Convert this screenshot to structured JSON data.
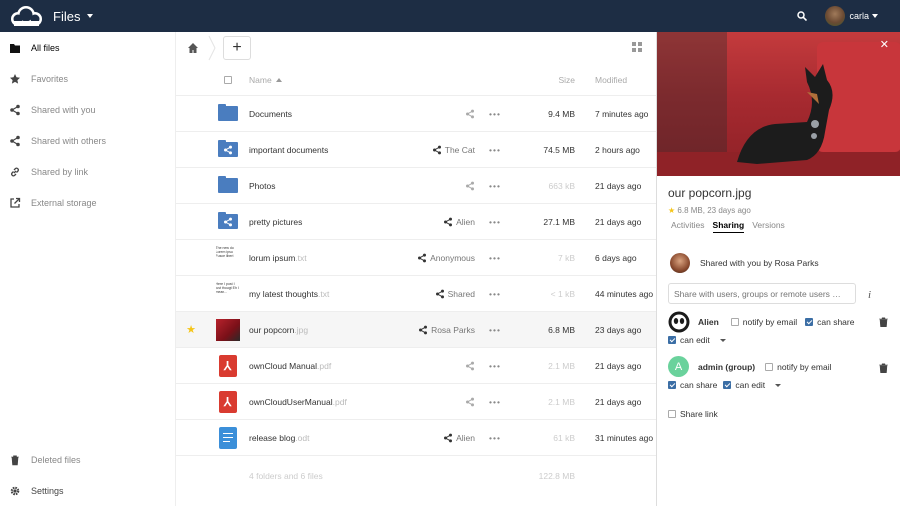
{
  "app": {
    "name": "Files",
    "user": "carla"
  },
  "sidebar": {
    "items": [
      {
        "label": "All files",
        "icon": "folder-icon",
        "active": true
      },
      {
        "label": "Favorites",
        "icon": "star-icon"
      },
      {
        "label": "Shared with you",
        "icon": "share-icon"
      },
      {
        "label": "Shared with others",
        "icon": "share-icon"
      },
      {
        "label": "Shared by link",
        "icon": "link-icon"
      },
      {
        "label": "External storage",
        "icon": "external-icon"
      }
    ],
    "bottom": [
      {
        "label": "Deleted files",
        "icon": "trash-icon"
      },
      {
        "label": "Settings",
        "icon": "gear-icon"
      }
    ]
  },
  "toolbar": {
    "add_label": "+"
  },
  "table": {
    "col_name": "Name",
    "col_size": "Size",
    "col_modified": "Modified"
  },
  "files": [
    {
      "name": "Documents",
      "ext": "",
      "type": "folder",
      "share": "",
      "size": "9.4 MB",
      "modified": "7 minutes ago"
    },
    {
      "name": "important documents",
      "ext": "",
      "type": "shared-folder",
      "share": "The Cat",
      "size": "74.5 MB",
      "modified": "2 hours ago"
    },
    {
      "name": "Photos",
      "ext": "",
      "type": "folder",
      "share": "",
      "size": "663 kB",
      "modified": "21 days ago",
      "light": true
    },
    {
      "name": "pretty pictures",
      "ext": "",
      "type": "shared-folder",
      "share": "Alien",
      "size": "27.1 MB",
      "modified": "21 days ago"
    },
    {
      "name": "lorum ipsum",
      "ext": ".txt",
      "type": "text",
      "preview": "The new do Lorem ipsu Fusce liberi",
      "share": "Anonymous",
      "size": "7 kB",
      "modified": "6 days ago",
      "light": true
    },
    {
      "name": "my latest thoughts",
      "ext": ".txt",
      "type": "text",
      "preview": "Here I post I just thougt Eh I mean...",
      "share": "Shared",
      "size": "< 1 kB",
      "modified": "44 minutes ago",
      "light": true
    },
    {
      "name": "our popcorn",
      "ext": ".jpg",
      "type": "image",
      "share": "Rosa Parks",
      "size": "6.8 MB",
      "modified": "23 days ago",
      "favorite": true,
      "selected": true
    },
    {
      "name": "ownCloud Manual",
      "ext": ".pdf",
      "type": "pdf",
      "share": "",
      "size": "2.1 MB",
      "modified": "21 days ago",
      "light": true
    },
    {
      "name": "ownCloudUserManual",
      "ext": ".pdf",
      "type": "pdf",
      "share": "",
      "size": "2.1 MB",
      "modified": "21 days ago",
      "light": true
    },
    {
      "name": "release blog",
      "ext": ".odt",
      "type": "doc",
      "share": "Alien",
      "size": "61 kB",
      "modified": "31 minutes ago",
      "light": true
    }
  ],
  "summary": {
    "count": "4 folders and 6 files",
    "size": "122.8 MB"
  },
  "detail": {
    "filename": "our popcorn.jpg",
    "meta": "6.8 MB, 23 days ago",
    "tabs": [
      "Activities",
      "Sharing",
      "Versions"
    ],
    "active_tab": 1,
    "owner_text": "Shared with you by Rosa Parks",
    "share_placeholder": "Share with users, groups or remote users …",
    "info": "i",
    "shares": [
      {
        "name": "Alien",
        "notify_label": "notify by email",
        "notify": false,
        "can_share_label": "can share",
        "can_share": true,
        "can_edit_label": "can edit",
        "can_edit": true
      },
      {
        "name": "admin (group)",
        "notify_label": "notify by email",
        "notify": false,
        "can_share_label": "can share",
        "can_share": true,
        "can_edit_label": "can edit",
        "can_edit": true
      }
    ],
    "share_link_label": "Share link"
  }
}
